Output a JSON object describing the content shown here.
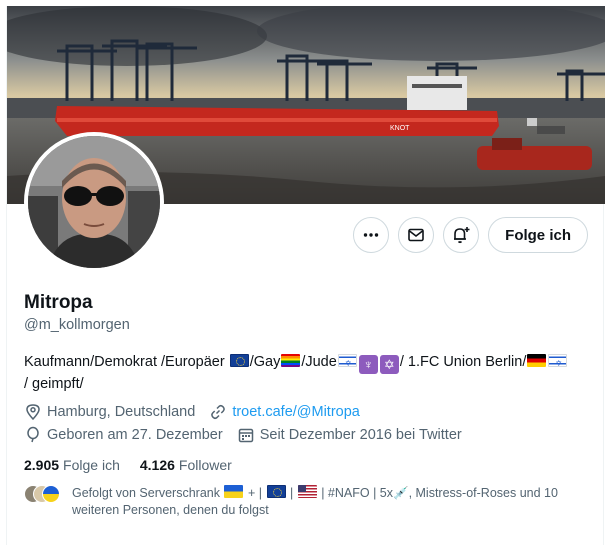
{
  "profile": {
    "name": "Mitropa",
    "handle": "@m_kollmorgen",
    "bio": {
      "part1": "Kaufmann/Demokrat /Europäer",
      "part2": "/Gay",
      "part3": "/Jude",
      "part4": "/ 1.FC Union Berlin/",
      "part5": "/ geimpft/"
    },
    "location": "Hamburg, Deutschland",
    "website": "troet.cafe/@Mitropa",
    "birthday": "Geboren am 27. Dezember",
    "joined": "Seit Dezember 2016 bei Twitter"
  },
  "stats": {
    "following_count": "2.905",
    "following_label": "Folge ich",
    "followers_count": "4.126",
    "followers_label": "Follower"
  },
  "actions": {
    "follow_label": "Folge ich"
  },
  "followed_by": {
    "prefix": "Gefolgt von Serverschrank",
    "plus": "+",
    "sep1": "|",
    "sep2": "|",
    "nafo": "| #NAFO | 5x",
    "rest": ", Mistress-of-Roses und 10 weiteren Personen, denen du folgst"
  },
  "icons": {
    "more": "more-icon",
    "message": "mail-icon",
    "notify": "bell-plus-icon",
    "location": "location-pin-icon",
    "link": "link-icon",
    "birthday": "balloon-icon",
    "calendar": "calendar-icon"
  },
  "colors": {
    "link": "#1d9bf0",
    "muted": "#536471",
    "text": "#0f1419",
    "border": "#cfd9de"
  }
}
